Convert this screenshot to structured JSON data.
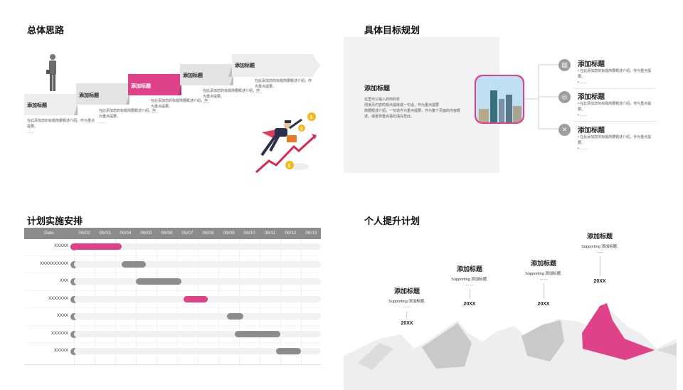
{
  "q1": {
    "title": "总体思路",
    "steps": [
      {
        "label": "添加标题",
        "desc": "在此添加您的标题简要概述介绍，作为重点提要。",
        "dots": "……"
      },
      {
        "label": "添加标题",
        "desc": "在此添加您的标题简要概述介绍，作为重点提要。",
        "dots": "……"
      },
      {
        "label": "添加标题",
        "desc": "在此添加您的标题简要概述介绍，作为重点提要。",
        "dots": "……"
      },
      {
        "label": "添加标题",
        "desc": "在此添加您的标题简要概述介绍，作为重点提要。",
        "dots": "……"
      },
      {
        "label": "添加标题",
        "desc": "在此添加您的标题简要概述介绍，作为重点提要。",
        "dots": "……"
      }
    ],
    "accent": "#e0428a"
  },
  "q2": {
    "title": "具体目标规划",
    "panel_title": "添加标题",
    "panel_lines": [
      "这里可以输入的你的析",
      "把该页内容的观点提炼成一句话，作为重点提要",
      "简要概述介绍，一句话作为重点提要，作为整个页面的内容概",
      "述，或者将重点语句填充至此。"
    ],
    "items": [
      {
        "icon": "chart-icon",
        "glyph": "▥",
        "title": "添加标题",
        "desc": "在此添加您的标题简要概述介绍，作为重点提要。",
        "dots": "……"
      },
      {
        "icon": "target-icon",
        "glyph": "◎",
        "title": "添加标题",
        "desc": "在此添加您的标题简要概述介绍，作为重点提要。",
        "dots": "……"
      },
      {
        "icon": "tools-icon",
        "glyph": "✕",
        "title": "添加标题",
        "desc": "在此添加您的标题简要概述介绍，作为重点提要。",
        "dots": "……"
      }
    ]
  },
  "q3": {
    "title": "计划实施安排",
    "header_label": "Date",
    "dates": [
      "06/02",
      "06/03",
      "06/04",
      "06/05",
      "06/06",
      "06/07",
      "06/08",
      "06/09",
      "06/10",
      "06/11",
      "06/12",
      "06/13"
    ],
    "rows": [
      {
        "label": "XXXXX",
        "start": 0,
        "span": 2.3,
        "highlight": true
      },
      {
        "label": "XXXXXXXXXX",
        "start": 2.3,
        "span": 1.2,
        "highlight": false
      },
      {
        "label": "XXX",
        "start": 3.0,
        "span": 2.2,
        "highlight": false
      },
      {
        "label": "XXXXXXX",
        "start": 5.3,
        "span": 1.2,
        "highlight": false
      },
      {
        "label": "XXXX",
        "start": 7.4,
        "span": 0.8,
        "highlight": false
      },
      {
        "label": "XXXXXX",
        "start": 7.8,
        "span": 2.2,
        "highlight": false
      },
      {
        "label": "XXXXX",
        "start": 9.8,
        "span": 1.2,
        "highlight": false
      }
    ],
    "accent": "#e0428a"
  },
  "q4": {
    "title": "个人提升计划",
    "peaks": [
      {
        "title": "添加标题",
        "sub": "Supporting 添加标题.",
        "dots": "……",
        "year": "20XX"
      },
      {
        "title": "添加标题",
        "sub": "Supporting 添加标题.",
        "dots": "……",
        "year": "20XX"
      },
      {
        "title": "添加标题",
        "sub": "Supporting 添加标题.",
        "dots": "……",
        "year": "20XX"
      },
      {
        "title": "添加标题",
        "sub": "Supporting 添加标题.",
        "dots": "……",
        "year": "20XX"
      }
    ]
  }
}
